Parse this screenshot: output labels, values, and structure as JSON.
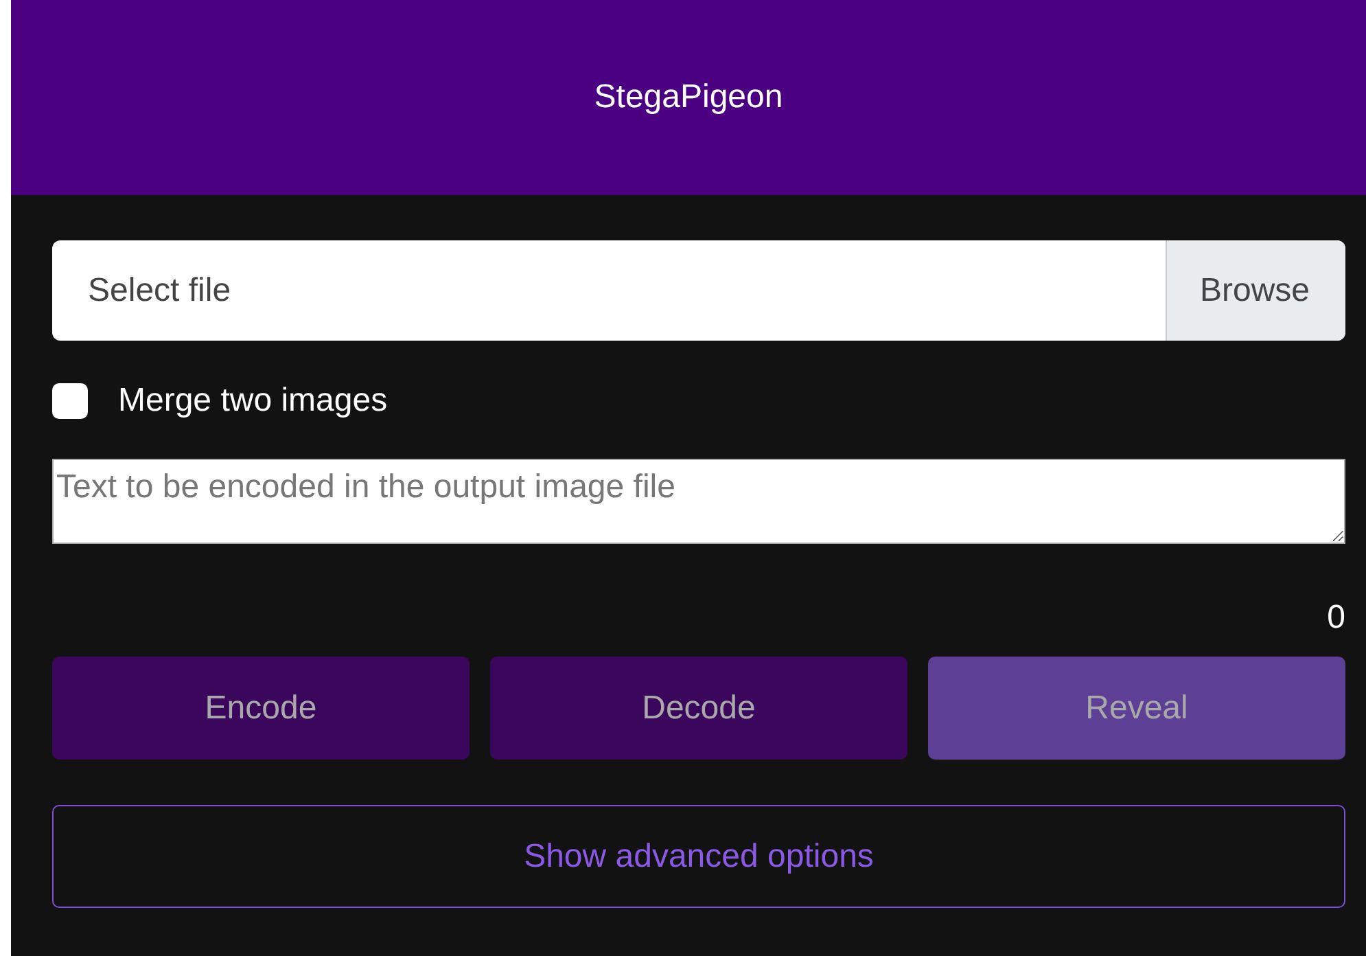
{
  "header": {
    "title": "StegaPigeon"
  },
  "file_input": {
    "placeholder": "Select file",
    "button": "Browse"
  },
  "merge_checkbox": {
    "label": "Merge two images",
    "checked": false
  },
  "message": {
    "placeholder": "Text to be encoded in the output image file"
  },
  "char_count": "0",
  "actions": [
    {
      "label": "Encode",
      "kind": "dark"
    },
    {
      "label": "Decode",
      "kind": "dark"
    },
    {
      "label": "Reveal",
      "kind": "light"
    }
  ],
  "advanced_button": "Show advanced options"
}
